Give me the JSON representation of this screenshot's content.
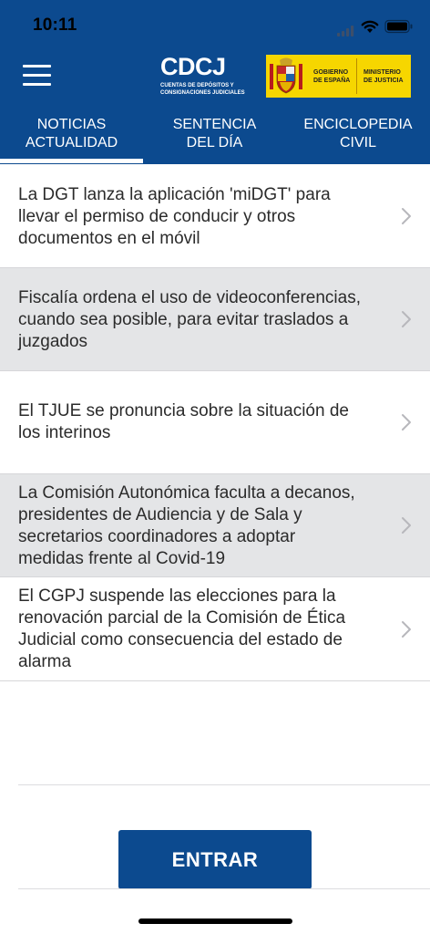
{
  "status_bar": {
    "time": "10:11"
  },
  "header": {
    "logo": {
      "title": "CDCJ",
      "subtitle_line1": "CUENTAS DE DEPÓSITOS Y",
      "subtitle_line2": "CONSIGNACIONES JUDICIALES"
    },
    "gov_logo": {
      "left_line1": "GOBIERNO",
      "left_line2": "DE ESPAÑA",
      "right_line1": "MINISTERIO",
      "right_line2": "DE JUSTICIA"
    }
  },
  "tabs": [
    {
      "line1": "NOTICIAS",
      "line2": "ACTUALIDAD",
      "active": true
    },
    {
      "line1": "SENTENCIA",
      "line2": "DEL DÍA",
      "active": false
    },
    {
      "line1": "ENCICLOPEDIA",
      "line2": "CIVIL",
      "active": false
    }
  ],
  "news": [
    {
      "lines": [
        "La DGT lanza la aplicación 'miDGT' para",
        "llevar el permiso de conducir y otros",
        "documentos en el móvil"
      ]
    },
    {
      "lines": [
        "Fiscalía ordena el uso de videoconferencias,",
        "cuando sea posible, para evitar traslados a",
        "juzgados"
      ]
    },
    {
      "lines": [
        "El TJUE se pronuncia sobre la situación de",
        "los interinos"
      ]
    },
    {
      "lines": [
        "La Comisión Autonómica faculta a decanos,",
        "presidentes de Audiencia y de Sala y",
        "secretarios coordinadores a adoptar",
        "medidas frente al Covid-19"
      ]
    },
    {
      "lines": [
        "El CGPJ suspende las elecciones para la",
        "renovación parcial de la Comisión de Ética",
        "Judicial como consecuencia del estado de",
        "alarma"
      ]
    }
  ],
  "enter_button": {
    "label": "ENTRAR"
  },
  "colors": {
    "primary": "#0c4a8f",
    "alt_row": "#e4e5e7",
    "text": "#2b2b2b",
    "gov_yellow": "#f6d600"
  }
}
